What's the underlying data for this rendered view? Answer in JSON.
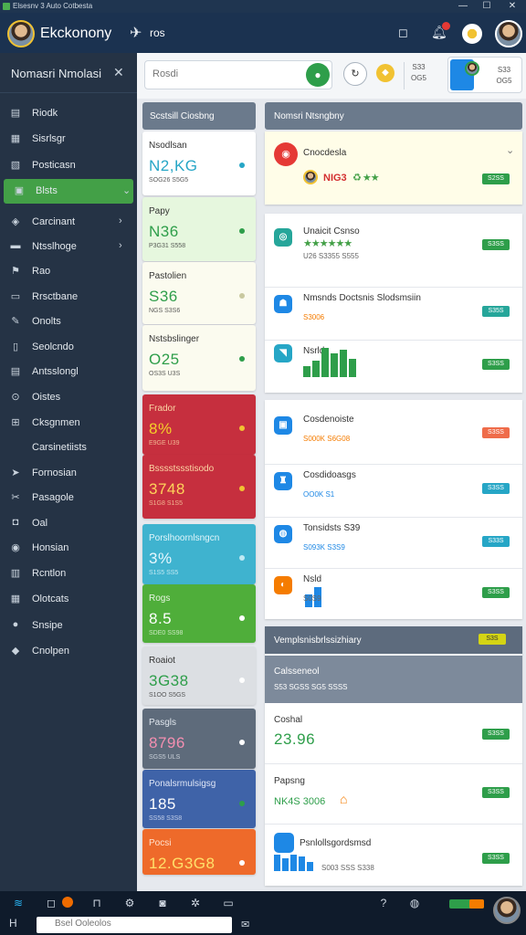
{
  "titlebar": {
    "title": "Elsesnv 3 Auto Cotbesta",
    "min": "—",
    "max": "☐",
    "close": "✕"
  },
  "appbar": {
    "title": "Ekckonony",
    "sub_label": "ros"
  },
  "sidebar": {
    "title": "Nomasri Nmolasi",
    "items": [
      {
        "label": "Riodk",
        "icon": "▤"
      },
      {
        "label": "Sisrlsgr",
        "icon": "▦"
      },
      {
        "label": "Posticasn",
        "icon": "▧"
      },
      {
        "label": "Blsts",
        "icon": "▣",
        "active": true
      },
      {
        "label": "Carcinant",
        "icon": "◈",
        "chevron": "›"
      },
      {
        "label": "Ntsslhoge",
        "icon": "▬",
        "chevron": "›"
      },
      {
        "label": "Rao",
        "icon": "⚑"
      },
      {
        "label": "Rrsctbane",
        "icon": "▭"
      },
      {
        "label": "Onolts",
        "icon": "✎"
      },
      {
        "label": "Seolcndo",
        "icon": "▯"
      },
      {
        "label": "Antsslongl",
        "icon": "▤"
      },
      {
        "label": "Oistes",
        "icon": "⊙"
      },
      {
        "label": "Cksgnmen",
        "icon": "⊞"
      },
      {
        "label": "Carsinetiists",
        "icon": ""
      },
      {
        "label": "Fornosian",
        "icon": "➤"
      },
      {
        "label": "Pasagole",
        "icon": "✂"
      },
      {
        "label": "Oal",
        "icon": "◘"
      },
      {
        "label": "Honsian",
        "icon": "◉"
      },
      {
        "label": "Rcntlon",
        "icon": "▥"
      },
      {
        "label": "Olotcats",
        "icon": "▦"
      },
      {
        "label": "Snsipe",
        "icon": "●"
      },
      {
        "label": "Cnolpen",
        "icon": "◆"
      }
    ]
  },
  "search": {
    "placeholder": "Rosdi"
  },
  "topbar": {
    "chip1_top": "S33",
    "chip1_bottom": "OG5",
    "chip2_top": "S33",
    "chip2_bottom": "OG5"
  },
  "left_col": {
    "header": "Scstsill Ciosbng",
    "kpis": [
      {
        "label": "Nsodlsan",
        "value": "N2,KG",
        "sub": "SOG26 S5G5"
      },
      {
        "label": "Papy",
        "value": "N36",
        "sub": "P3G31 S558"
      },
      {
        "label": "Pastolien",
        "value": "S36",
        "sub": "NGS S3S6"
      },
      {
        "label": "Nstsbslinger",
        "value": "O25",
        "sub": "OS3S U3S"
      },
      {
        "label": "Frador",
        "value": "8%",
        "sub": "E9GE U39"
      },
      {
        "label": "Bsssstssstisodo",
        "value": "3748",
        "sub": "S1G8 S1S5"
      },
      {
        "label": "Porslhoornlsngcn",
        "value": "3%",
        "sub": "S1S5 SS5"
      },
      {
        "label": "Rogs",
        "value": "8.5",
        "sub": "SDE0 SS98"
      },
      {
        "label": "Roaiot",
        "value": "3G38",
        "sub": "S1OO S5GS"
      },
      {
        "label": "Pasgls",
        "value": "8796",
        "sub": "SGS5 ULS"
      },
      {
        "label": "Ponalsrmulsigsg",
        "value": "185",
        "sub": "SS58 S3S8"
      },
      {
        "label": "Pocsi",
        "value": "12.G3G8",
        "sub": ""
      }
    ]
  },
  "right_col": {
    "header": "Nomsri Ntsngbny",
    "featured": {
      "title": "Cnocdesla",
      "amount": "NIG3",
      "badge": "S2SS"
    },
    "items": [
      {
        "title": "Unaicit Csnso",
        "sub": "U26 S3355 S555",
        "badge": "S3SS",
        "badge_color": "#2e9e4a"
      },
      {
        "title": "Nmsnds Doctsnis Slodsmsiin",
        "sub": "S3006",
        "badge": "S35S",
        "badge_color": "#26a69a"
      },
      {
        "title": "Nsrld",
        "sub": "",
        "badge": "S3SS",
        "badge_color": "#2e9e4a"
      },
      {
        "title": "Cosdenoiste",
        "sub": "S000K S6G08",
        "badge": "S3SS",
        "badge_color": "#ef6c4a"
      },
      {
        "title": "Cosdidoasgs",
        "sub": "OO0K S1",
        "badge": "S3SS",
        "badge_color": "#26a6c6"
      },
      {
        "title": "Tonsidsts S39",
        "sub": "S093K S3S9",
        "badge": "S33S",
        "badge_color": "#26a6c6"
      },
      {
        "title": "Nsld",
        "sub": "S0S9",
        "badge": "S3SS",
        "badge_color": "#2e9e4a"
      }
    ],
    "bottom_panel": {
      "header": "Vemplsnisbrlssizhiary",
      "header_badge": "S3S",
      "sub_header": "Calsseneol",
      "sub_value": "S53 SGSS SG5 SSSS",
      "entries": [
        {
          "label": "Coshal",
          "value": "23.96",
          "badge": "S3SS"
        },
        {
          "label": "Papsng",
          "value": "NK4S 3006",
          "badge": "S3SS"
        },
        {
          "label": "Psnlollsgordsmsd",
          "value": "S003 SSS S338",
          "badge": "S3SS"
        }
      ]
    }
  },
  "taskbar": {
    "search_placeholder": "Bsel Ooleolos"
  },
  "colors": {
    "accent": "#2e9e4a",
    "sidebar": "#253345",
    "appbar": "#1b3250"
  }
}
